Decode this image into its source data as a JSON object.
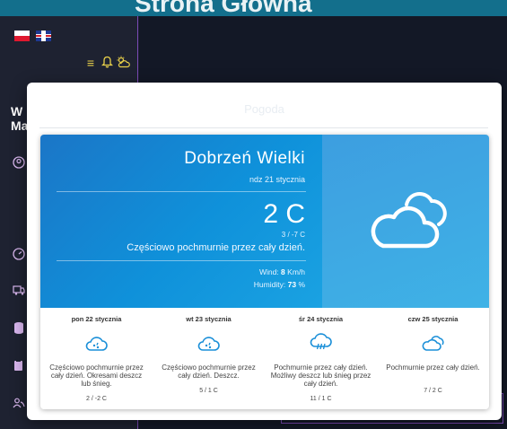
{
  "app": {
    "header_title": "Strona Główna",
    "user_initials_line1": "W",
    "user_initials_line2": "Ma"
  },
  "modal": {
    "title": "Pogoda"
  },
  "weather": {
    "city": "Dobrzeń Wielki",
    "date": "ndz 21 stycznia",
    "temperature": "2 C",
    "min_max": "3 / -7 C",
    "description": "Częściowo pochmurnie przez cały dzień.",
    "wind_label": "Wind:",
    "wind_value": "8",
    "wind_unit": "Km/h",
    "humidity_label": "Humidity:",
    "humidity_value": "73",
    "humidity_unit": "%",
    "icon": "cloud-icon"
  },
  "forecast": [
    {
      "day": "pon 22 stycznia",
      "description": "Częściowo pochmurnie przez cały dzień. Okresami deszcz lub śnieg.",
      "temp": "2 / -2 C",
      "icon": "rain-snow-icon"
    },
    {
      "day": "wt 23 stycznia",
      "description": "Częściowo pochmurnie przez cały dzień. Deszcz.",
      "temp": "5 / 1 C",
      "icon": "rain-snow-icon"
    },
    {
      "day": "śr 24 stycznia",
      "description": "Pochmurnie przez cały dzień. Możliwy deszcz lub śnieg przez cały dzień.",
      "temp": "11 / 1 C",
      "icon": "rain-icon"
    },
    {
      "day": "czw 25 stycznia",
      "description": "Pochmurnie przez cały dzień.",
      "temp": "7 / 2 C",
      "icon": "cloud-icon"
    }
  ],
  "colors": {
    "hero_blue": "#0f91da",
    "icon_blue": "#1a8fd8",
    "accent_purple": "#7b4ab5",
    "header_teal": "#136f8c"
  }
}
